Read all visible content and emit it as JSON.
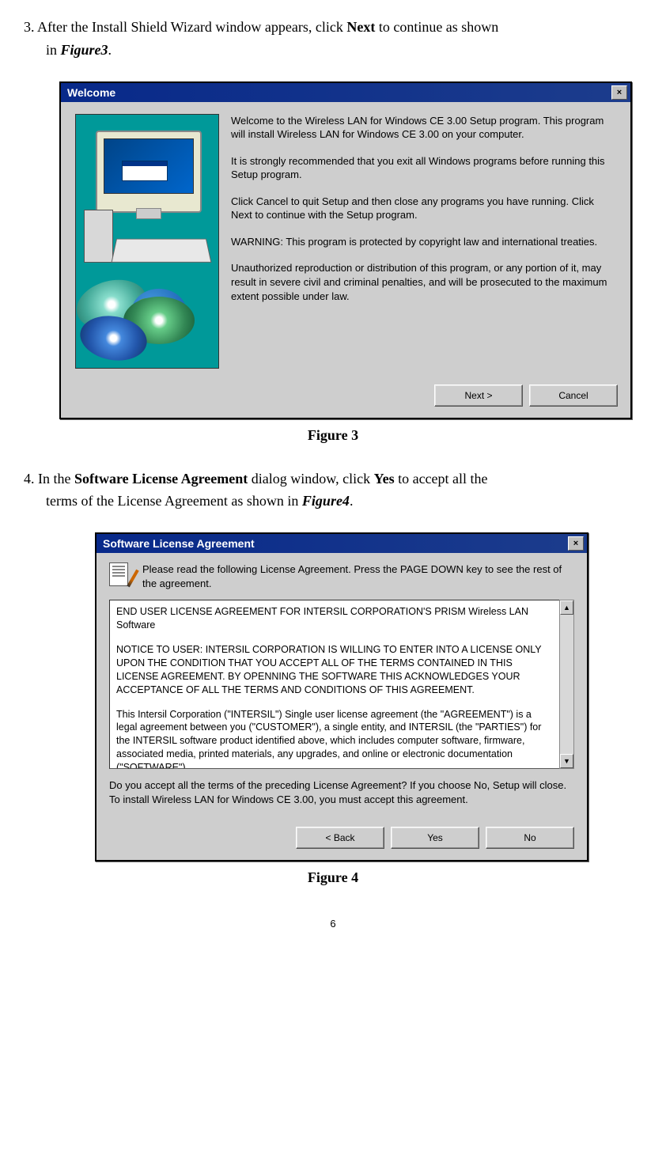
{
  "step3": {
    "num": "3.",
    "t1": "After the Install Shield Wizard window appears, click ",
    "bold1": "Next",
    "t2": " to continue as shown",
    "t3": "in ",
    "figref": "Figure3",
    "t4": "."
  },
  "welcome_dialog": {
    "title": "Welcome",
    "close": "×",
    "p1": "Welcome to the Wireless LAN for Windows CE 3.00 Setup program.  This program will install Wireless LAN for Windows CE 3.00 on your computer.",
    "p2": "It is strongly recommended that you exit all Windows programs before running this Setup program.",
    "p3": "Click Cancel to quit Setup and then close any programs you have running.  Click Next to continue with the Setup program.",
    "p4": "WARNING: This program is protected by copyright law and international treaties.",
    "p5": "Unauthorized reproduction or distribution of this program, or any portion of it, may result in severe civil and criminal penalties, and will be prosecuted to the maximum extent possible under law.",
    "btn_next": "Next >",
    "btn_cancel": "Cancel"
  },
  "figure3_caption": "Figure 3",
  "step4": {
    "num": "4.",
    "t1": "In the ",
    "bold1": "Software License Agreement",
    "t2": " dialog window, click ",
    "bold2": "Yes",
    "t3": " to accept all the",
    "t4": "terms of the License Agreement as shown in ",
    "figref": "Figure4",
    "t5": "."
  },
  "license_dialog": {
    "title": "Software License Agreement",
    "close": "×",
    "instructions": "Please read the following License Agreement.  Press the PAGE DOWN key to see the rest of the agreement.",
    "body_p1": "END USER LICENSE AGREEMENT FOR INTERSIL CORPORATION'S PRISM Wireless LAN Software",
    "body_p2": "NOTICE TO USER: INTERSIL CORPORATION IS WILLING TO ENTER INTO A LICENSE ONLY UPON THE CONDITION THAT YOU ACCEPT ALL OF THE TERMS CONTAINED IN THIS LICENSE AGREEMENT. BY OPENNING THE SOFTWARE THIS ACKNOWLEDGES YOUR ACCEPTANCE OF ALL THE TERMS AND CONDITIONS OF THIS AGREEMENT.",
    "body_p3": "This Intersil Corporation (\"INTERSIL\") Single user license agreement (the \"AGREEMENT\") is a legal agreement between you (\"CUSTOMER\"), a single entity, and INTERSIL (the \"PARTIES\") for the INTERSIL software product identified above, which includes computer software, firmware, associated media, printed materials, any upgrades, and online or electronic documentation (\"SOFTWARE\").",
    "question": "Do you accept all the terms of the preceding License Agreement?  If you choose No, Setup will close.  To install Wireless LAN for Windows CE 3.00, you must accept this agreement.",
    "btn_back": "< Back",
    "btn_yes": "Yes",
    "btn_no": "No",
    "scroll_up": "▲",
    "scroll_down": "▼"
  },
  "figure4_caption": "Figure 4",
  "page_number": "6"
}
